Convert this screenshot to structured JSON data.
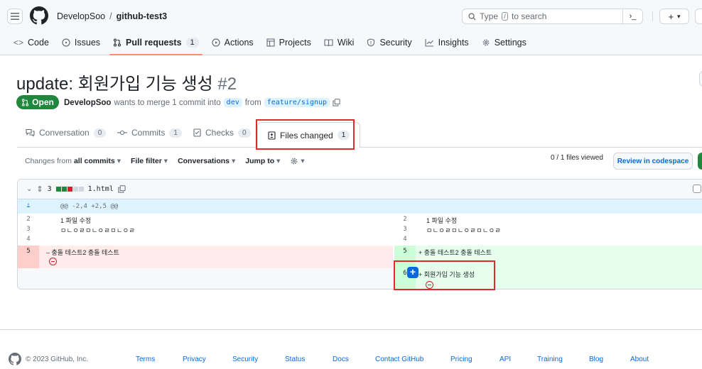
{
  "header": {
    "owner": "DevelopSoo",
    "separator": "/",
    "repo": "github-test3",
    "search_prefix": "Type",
    "search_key": "/",
    "search_suffix": "to search",
    "command_symbol": "›_",
    "plus_symbol": "+",
    "caret_symbol": "▾"
  },
  "repo_nav": {
    "code": "Code",
    "issues": "Issues",
    "pull_requests": "Pull requests",
    "pull_requests_count": "1",
    "actions": "Actions",
    "projects": "Projects",
    "wiki": "Wiki",
    "security": "Security",
    "insights": "Insights",
    "settings": "Settings"
  },
  "pr": {
    "title": "update: 회원가입 기능 생성",
    "number": "#2",
    "state": "Open",
    "author": "DevelopSoo",
    "meta_text": "wants to merge 1 commit into",
    "base_branch": "dev",
    "from_text": "from",
    "head_branch": "feature/signup"
  },
  "tabs": {
    "conversation": "Conversation",
    "conversation_count": "0",
    "commits": "Commits",
    "commits_count": "1",
    "checks": "Checks",
    "checks_count": "0",
    "files_changed": "Files changed",
    "files_changed_count": "1"
  },
  "toolbar": {
    "changes_from_label": "Changes from",
    "changes_from_value": "all commits",
    "file_filter": "File filter",
    "conversations": "Conversations",
    "jump_to": "Jump to",
    "files_viewed": "0 / 1 files viewed",
    "review_button": "Review in codespace"
  },
  "file": {
    "changes_count": "3",
    "filename": "1.html",
    "hunk_marker": "⊥",
    "hunk_header": "@@ -2,4 +2,5 @@",
    "lines": {
      "l2_num": "2",
      "l2_text": "1 파일 수정",
      "l3_num": "3",
      "l3_text": "ㅁㄴㅇㄹㅁㄴㅇㄹㅁㄴㅇㄹ",
      "l4_num": "4",
      "l5_num": "5",
      "l5_del_text": "– 충돌 테스트2 충돌 테스트",
      "l5_add_text": "+ 충돌 테스트2 충돌 테스트",
      "r6_num": "6",
      "r6_text": "+ 회원가입 기능 생성"
    }
  },
  "footer": {
    "copyright": "© 2023 GitHub, Inc.",
    "links": [
      "Terms",
      "Privacy",
      "Security",
      "Status",
      "Docs",
      "Contact GitHub",
      "Pricing",
      "API",
      "Training",
      "Blog",
      "About"
    ]
  }
}
